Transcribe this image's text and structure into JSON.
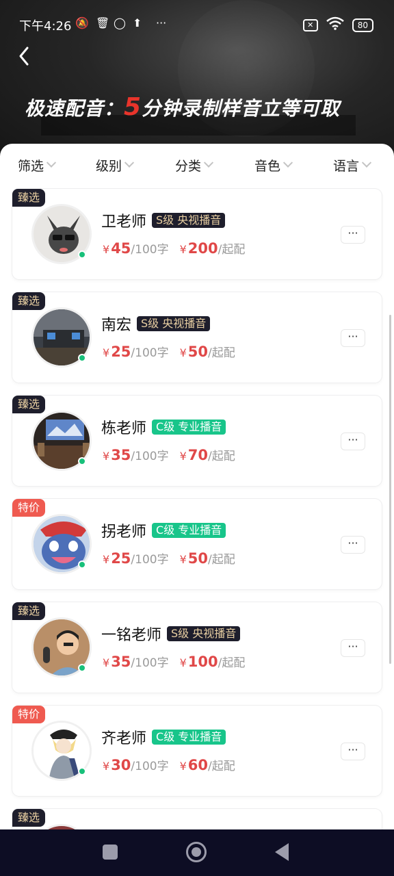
{
  "status_bar": {
    "time": "下午4:26",
    "dots": "···",
    "battery": "80"
  },
  "banner": {
    "part1": "极速配音：",
    "number": "5",
    "part2": "分钟录制样音立等可取"
  },
  "filters": [
    {
      "label": "筛选"
    },
    {
      "label": "级别"
    },
    {
      "label": "分类"
    },
    {
      "label": "音色"
    },
    {
      "label": "语言"
    }
  ],
  "price_units": {
    "currency": "¥",
    "per_chars": "/100字",
    "min": "/起配"
  },
  "more_label": "···",
  "voice_actors": [
    {
      "tag": "臻选",
      "tag_type": "pick",
      "name": "卫老师",
      "level": "S级 央视播音",
      "level_type": "s",
      "price": "45",
      "min_price": "200",
      "avatar": "cat-avatar"
    },
    {
      "tag": "臻选",
      "tag_type": "pick",
      "name": "南宏",
      "level": "S级 央视播音",
      "level_type": "s",
      "price": "25",
      "min_price": "50",
      "avatar": "studio-avatar"
    },
    {
      "tag": "臻选",
      "tag_type": "pick",
      "name": "栋老师",
      "level": "C级 专业播音",
      "level_type": "c",
      "price": "35",
      "min_price": "70",
      "avatar": "studio-screen-avatar"
    },
    {
      "tag": "特价",
      "tag_type": "sale",
      "name": "拐老师",
      "level": "C级 专业播音",
      "level_type": "c",
      "price": "25",
      "min_price": "50",
      "avatar": "cartoon-avatar"
    },
    {
      "tag": "臻选",
      "tag_type": "pick",
      "name": "一铭老师",
      "level": "S级 央视播音",
      "level_type": "s",
      "price": "35",
      "min_price": "100",
      "avatar": "person-mic-avatar"
    },
    {
      "tag": "特价",
      "tag_type": "sale",
      "name": "齐老师",
      "level": "C级 专业播音",
      "level_type": "c",
      "price": "30",
      "min_price": "60",
      "avatar": "anime-avatar"
    },
    {
      "tag": "臻选",
      "tag_type": "pick"
    }
  ],
  "colors": {
    "price": "#e04848",
    "online": "#18c07a",
    "level_s_bg": "#1e1e2c",
    "level_c_bg": "#18c58a"
  }
}
